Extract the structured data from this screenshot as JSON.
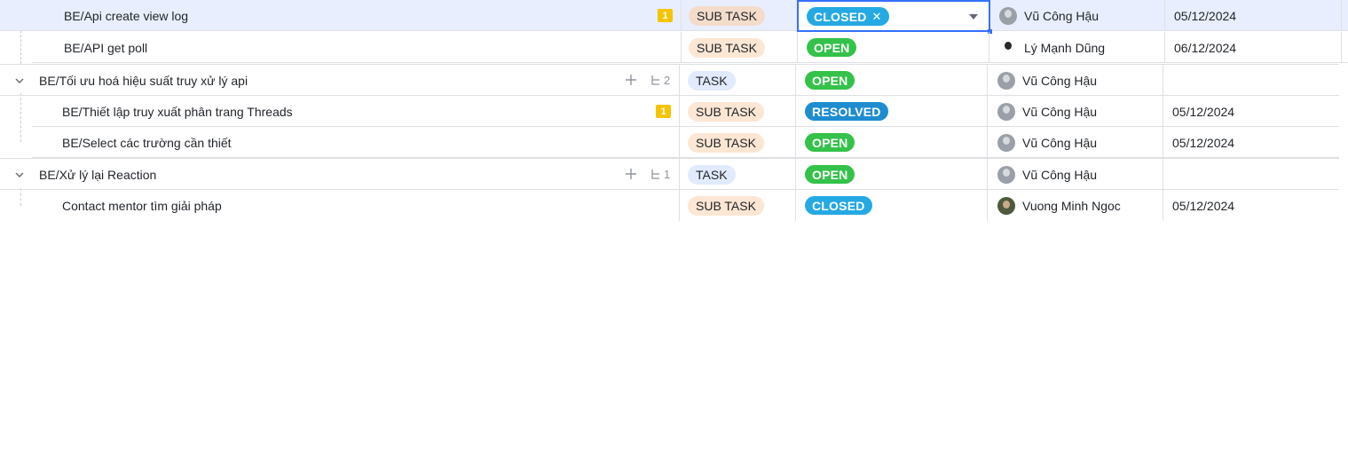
{
  "rows": [
    {
      "title": "BE/Api create view log",
      "type": "SUB TASK",
      "status": "CLOSED",
      "assignee": "Vũ Công Hậu",
      "due": "05/12/2024",
      "badge": "1"
    },
    {
      "title": "BE/API get poll",
      "type": "SUB TASK",
      "status": "OPEN",
      "assignee": "Lý Mạnh Dũng",
      "due": "06/12/2024"
    },
    {
      "title": "BE/Tối ưu hoá hiệu suất truy xử lý api",
      "type": "TASK",
      "status": "OPEN",
      "assignee": "Vũ Công Hậu",
      "due": "",
      "subtask_count": "2"
    },
    {
      "title": "BE/Thiết lập truy xuất phân trang Threads",
      "type": "SUB TASK",
      "status": "RESOLVED",
      "assignee": "Vũ Công Hậu",
      "due": "05/12/2024",
      "badge": "1"
    },
    {
      "title": "BE/Select các trường cần thiết",
      "type": "SUB TASK",
      "status": "OPEN",
      "assignee": "Vũ Công Hậu",
      "due": "05/12/2024"
    },
    {
      "title": "BE/Xử lý lại Reaction",
      "type": "TASK",
      "status": "OPEN",
      "assignee": "Vũ Công Hậu",
      "due": "",
      "subtask_count": "1"
    },
    {
      "title": "Contact mentor tìm giải pháp",
      "type": "SUB TASK",
      "status": "CLOSED",
      "assignee": "Vuong Minh Ngoc",
      "due": "05/12/2024"
    }
  ],
  "icons": {
    "expand": "chevron-down-icon",
    "add": "plus-icon",
    "subtask": "subtask-tree-icon",
    "dropdown": "caret-down-icon",
    "remove": "close-icon"
  },
  "colors": {
    "open": "#34c24a",
    "closed": "#24a9e3",
    "resolved": "#1e8dd0",
    "selection_border": "#3370ff",
    "badge": "#f5c400"
  }
}
